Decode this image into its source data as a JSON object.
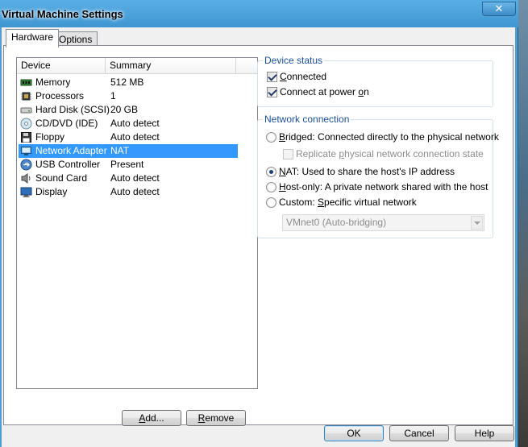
{
  "window": {
    "title": "Virtual Machine Settings",
    "close_label": "✕"
  },
  "tabs": [
    {
      "label": "Hardware",
      "active": true
    },
    {
      "label": "Options",
      "active": false
    }
  ],
  "device_list": {
    "columns": [
      "Device",
      "Summary"
    ],
    "rows": [
      {
        "device": "Memory",
        "summary": "512 MB",
        "icon": "memory-icon",
        "selected": false
      },
      {
        "device": "Processors",
        "summary": "1",
        "icon": "processor-icon",
        "selected": false
      },
      {
        "device": "Hard Disk (SCSI)",
        "summary": "20 GB",
        "icon": "hard-disk-icon",
        "selected": false
      },
      {
        "device": "CD/DVD (IDE)",
        "summary": "Auto detect",
        "icon": "cd-dvd-icon",
        "selected": false
      },
      {
        "device": "Floppy",
        "summary": "Auto detect",
        "icon": "floppy-icon",
        "selected": false
      },
      {
        "device": "Network Adapter",
        "summary": "NAT",
        "icon": "network-adapter-icon",
        "selected": true
      },
      {
        "device": "USB Controller",
        "summary": "Present",
        "icon": "usb-icon",
        "selected": false
      },
      {
        "device": "Sound Card",
        "summary": "Auto detect",
        "icon": "sound-card-icon",
        "selected": false
      },
      {
        "device": "Display",
        "summary": "Auto detect",
        "icon": "display-icon",
        "selected": false
      }
    ]
  },
  "buttons": {
    "add": "Add...",
    "remove": "Remove",
    "ok": "OK",
    "cancel": "Cancel",
    "help": "Help"
  },
  "device_status": {
    "label": "Device status",
    "connected": {
      "label": "Connected",
      "checked": true
    },
    "connect_power_on": {
      "label": "Connect at power on",
      "checked": true
    }
  },
  "network_connection": {
    "label": "Network connection",
    "bridged": {
      "label": "Bridged: Connected directly to the physical network",
      "checked": false
    },
    "replicate": {
      "label": "Replicate physical network connection state",
      "checked": false,
      "enabled": false
    },
    "nat": {
      "label": "NAT: Used to share the host's IP address",
      "checked": true
    },
    "host_only": {
      "label": "Host-only: A private network shared with the host",
      "checked": false
    },
    "custom": {
      "label": "Custom: Specific virtual network",
      "checked": false
    },
    "vnet_select": {
      "value": "VMnet0 (Auto-bridging)",
      "enabled": false
    }
  },
  "colors": {
    "selection": "#3399ff",
    "group_label": "#1a4f99",
    "title_bar": "#4f9ed6"
  }
}
